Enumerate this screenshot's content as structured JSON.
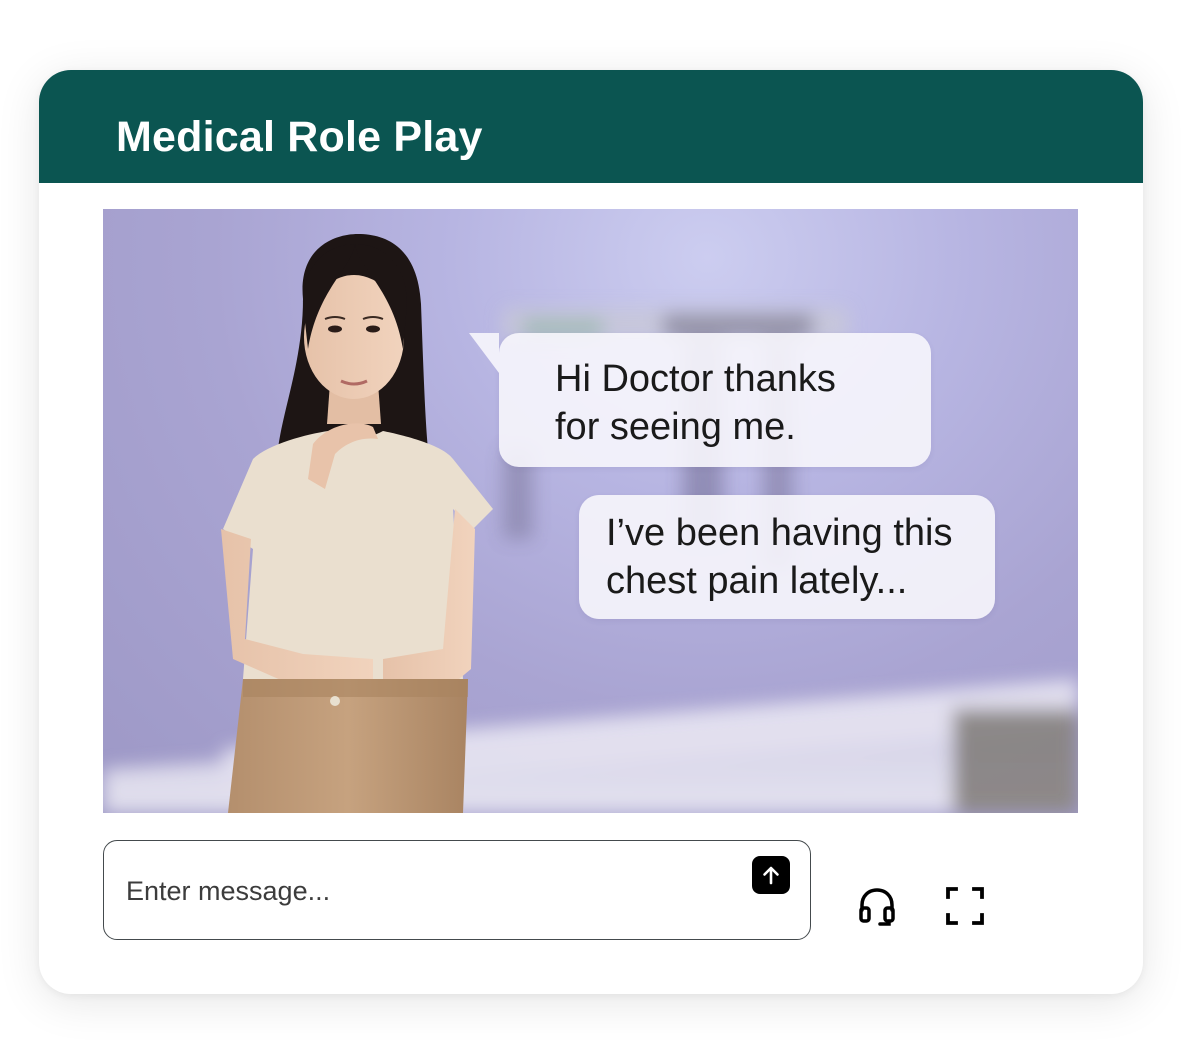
{
  "header": {
    "title": "Medical Role Play"
  },
  "scene": {
    "messages": [
      {
        "lines": [
          "Hi Doctor thanks",
          "for seeing me."
        ]
      },
      {
        "lines": [
          "I’ve been having this",
          "chest pain lately..."
        ]
      }
    ]
  },
  "composer": {
    "placeholder": "Enter message...",
    "send_icon": "arrow-up-icon"
  },
  "controls": {
    "headset_icon": "headset-icon",
    "fullscreen_icon": "fullscreen-icon"
  },
  "colors": {
    "header_bg": "#0b5551",
    "scene_bg": "#b7b5e2",
    "bubble_bg": "#f7f6fc"
  }
}
